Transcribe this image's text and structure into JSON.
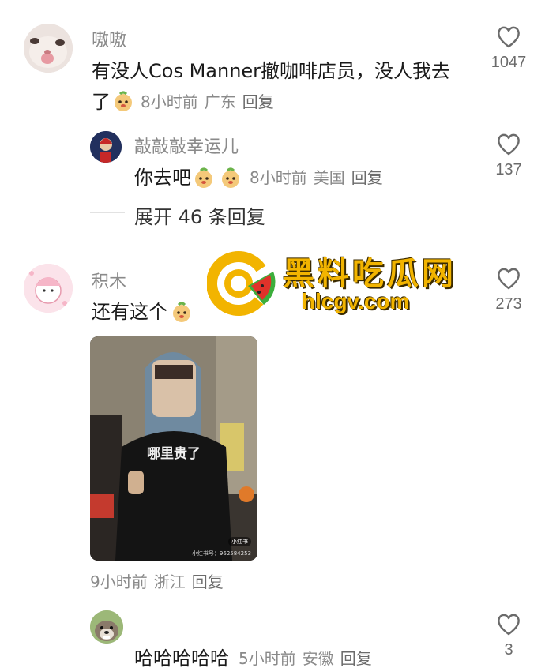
{
  "comments": [
    {
      "user": "嗷嗷",
      "text_line1": "有没人Cos Manner撤咖啡店员，没人我去",
      "text_line2": "了",
      "time": "8小时前",
      "location": "广东",
      "reply": "回复",
      "likes": "1047",
      "replies": [
        {
          "user": "敲敲敲幸运儿",
          "text": "你去吧",
          "time": "8小时前",
          "location": "美国",
          "reply": "回复",
          "likes": "137"
        }
      ],
      "expand": "展开 46 条回复"
    },
    {
      "user": "积木",
      "text": "还有这个",
      "time": "9小时前",
      "location": "浙江",
      "reply": "回复",
      "likes": "273",
      "image_caption": "哪里贵了",
      "image_chip": "小红书",
      "image_tag": "小红书号：962584253",
      "replies": [
        {
          "user": "",
          "text": "哈哈哈哈哈",
          "time": "5小时前",
          "location": "安徽",
          "reply": "回复",
          "likes": "3"
        }
      ]
    }
  ],
  "watermark": {
    "title": "黑料吃瓜网",
    "url": "hlcgv.com"
  },
  "colors": {
    "meta_gray": "#8a8a8a",
    "watermark_gold": "#f2b400",
    "watermark_green": "#3cae3c",
    "watermark_red": "#e0322a"
  }
}
